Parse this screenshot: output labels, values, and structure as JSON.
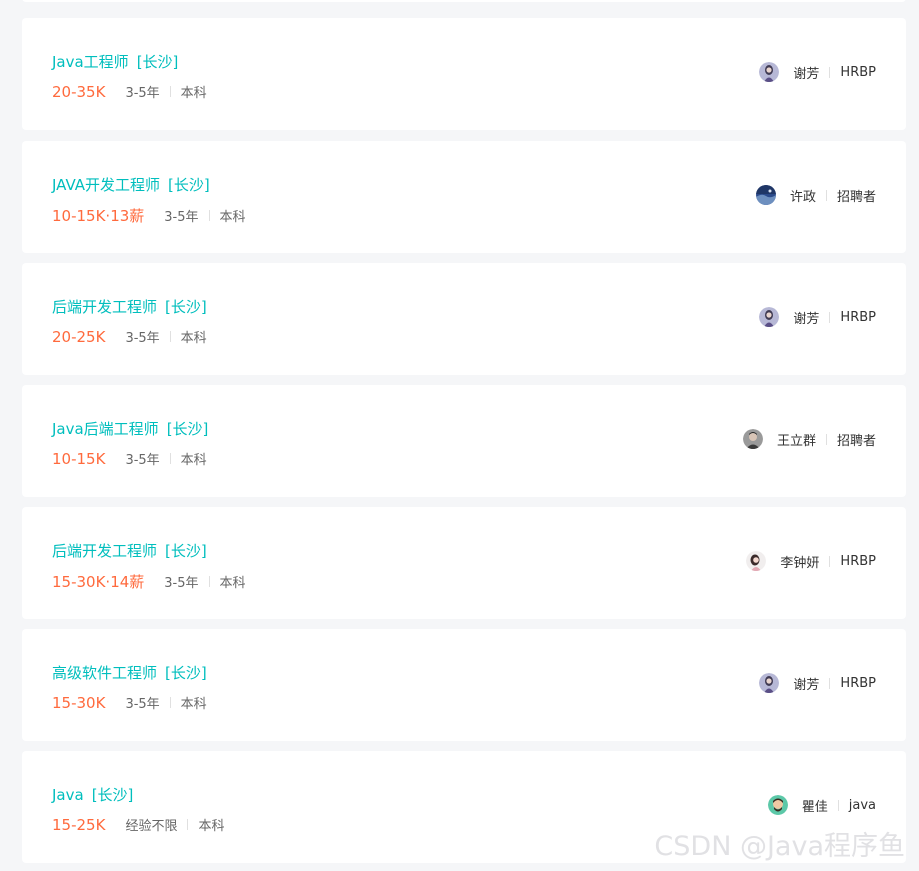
{
  "jobs": [
    {
      "title": "Java工程师",
      "city": "[长沙]",
      "salary": "20-35K",
      "experience": "3-5年",
      "degree": "本科",
      "recruiter_name": "谢芳",
      "recruiter_title": "HRBP",
      "avatar": "avatar-woman-purple"
    },
    {
      "title": "JAVA开发工程师",
      "city": "[长沙]",
      "salary": "10-15K·13薪",
      "experience": "3-5年",
      "degree": "本科",
      "recruiter_name": "许政",
      "recruiter_title": "招聘者",
      "avatar": "avatar-landscape-blue"
    },
    {
      "title": "后端开发工程师",
      "city": "[长沙]",
      "salary": "20-25K",
      "experience": "3-5年",
      "degree": "本科",
      "recruiter_name": "谢芳",
      "recruiter_title": "HRBP",
      "avatar": "avatar-woman-purple"
    },
    {
      "title": "Java后端工程师",
      "city": "[长沙]",
      "salary": "10-15K",
      "experience": "3-5年",
      "degree": "本科",
      "recruiter_name": "王立群",
      "recruiter_title": "招聘者",
      "avatar": "avatar-man-gray"
    },
    {
      "title": "后端开发工程师",
      "city": "[长沙]",
      "salary": "15-30K·14薪",
      "experience": "3-5年",
      "degree": "本科",
      "recruiter_name": "李钟妍",
      "recruiter_title": "HRBP",
      "avatar": "avatar-woman-light"
    },
    {
      "title": "高级软件工程师",
      "city": "[长沙]",
      "salary": "15-30K",
      "experience": "3-5年",
      "degree": "本科",
      "recruiter_name": "谢芳",
      "recruiter_title": "HRBP",
      "avatar": "avatar-woman-purple"
    },
    {
      "title": "Java",
      "city": "[长沙]",
      "salary": "15-25K",
      "experience": "经验不限",
      "degree": "本科",
      "recruiter_name": "瞿佳",
      "recruiter_title": "java",
      "avatar": "avatar-cartoon-green"
    }
  ],
  "watermark": "CSDN @Java程序鱼",
  "colors": {
    "title": "#00bebd",
    "salary": "#ff6a3d",
    "background": "#f5f6f8",
    "card": "#ffffff"
  }
}
